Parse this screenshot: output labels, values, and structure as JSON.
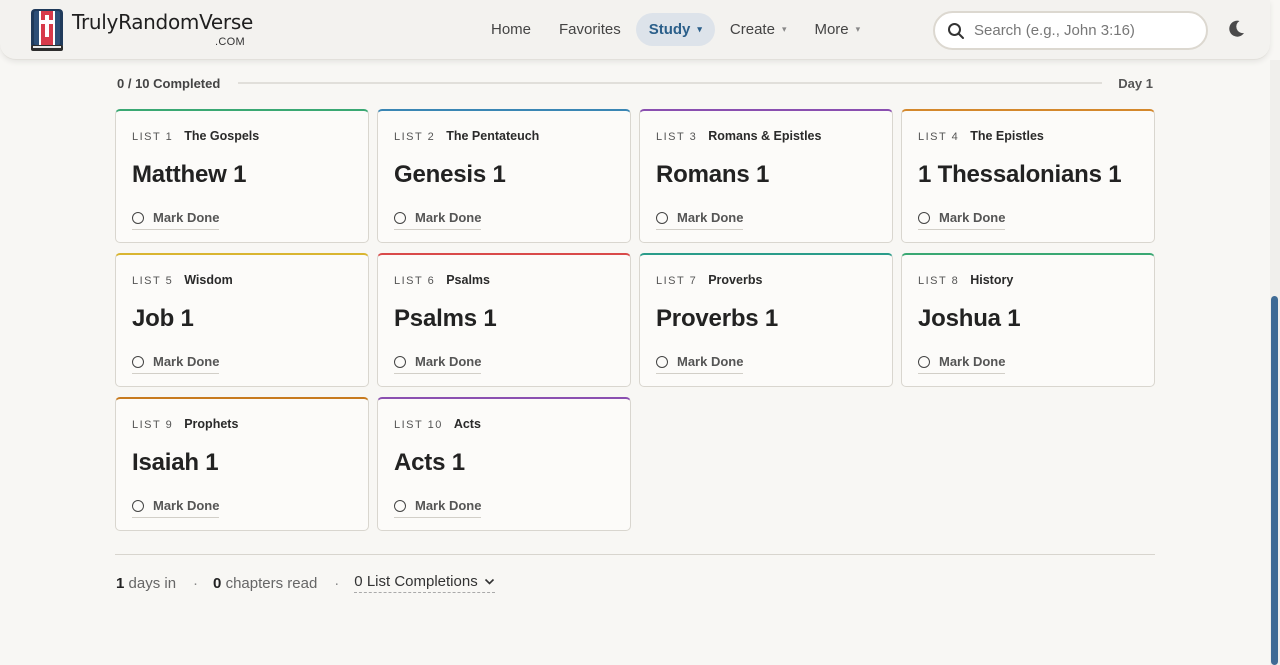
{
  "brand": {
    "name": "TrulyRandomVerse",
    "tld": ".COM"
  },
  "nav": [
    {
      "label": "Home",
      "has_menu": false,
      "active": false
    },
    {
      "label": "Favorites",
      "has_menu": false,
      "active": false
    },
    {
      "label": "Study",
      "has_menu": true,
      "active": true
    },
    {
      "label": "Create",
      "has_menu": true,
      "active": false
    },
    {
      "label": "More",
      "has_menu": true,
      "active": false
    }
  ],
  "search": {
    "placeholder": "Search (e.g., John 3:16)",
    "value": "",
    "icon": "search-icon"
  },
  "theme_toggle": {
    "icon": "moon-icon"
  },
  "progress": {
    "label": "0 / 10 Completed",
    "completed": 0,
    "total": 10,
    "day_label": "Day 1"
  },
  "lists": [
    {
      "num": "LIST 1",
      "name": "The Gospels",
      "chapter": "Matthew 1",
      "action": "Mark Done",
      "color": "#3aa873"
    },
    {
      "num": "LIST 2",
      "name": "The Pentateuch",
      "chapter": "Genesis 1",
      "action": "Mark Done",
      "color": "#3a86b4"
    },
    {
      "num": "LIST 3",
      "name": "Romans & Epistles",
      "chapter": "Romans 1",
      "action": "Mark Done",
      "color": "#8a4fb0"
    },
    {
      "num": "LIST 4",
      "name": "The Epistles",
      "chapter": "1 Thessalonians 1",
      "action": "Mark Done",
      "color": "#d4882c"
    },
    {
      "num": "LIST 5",
      "name": "Wisdom",
      "chapter": "Job 1",
      "action": "Mark Done",
      "color": "#d9b531"
    },
    {
      "num": "LIST 6",
      "name": "Psalms",
      "chapter": "Psalms 1",
      "action": "Mark Done",
      "color": "#d94a4a"
    },
    {
      "num": "LIST 7",
      "name": "Proverbs",
      "chapter": "Proverbs 1",
      "action": "Mark Done",
      "color": "#2a9c8a"
    },
    {
      "num": "LIST 8",
      "name": "History",
      "chapter": "Joshua 1",
      "action": "Mark Done",
      "color": "#3aa873"
    },
    {
      "num": "LIST 9",
      "name": "Prophets",
      "chapter": "Isaiah 1",
      "action": "Mark Done",
      "color": "#c77a1e"
    },
    {
      "num": "LIST 10",
      "name": "Acts",
      "chapter": "Acts 1",
      "action": "Mark Done",
      "color": "#8a4fb0"
    }
  ],
  "stats": {
    "days_value": "1",
    "days_label": "days in",
    "separator": "·",
    "chapters_value": "0",
    "chapters_label": "chapters read",
    "completions_value": "0",
    "completions_label": "List Completions"
  },
  "colors": {
    "accent": "#3f6b95",
    "active_nav_bg": "#dde3ea"
  }
}
